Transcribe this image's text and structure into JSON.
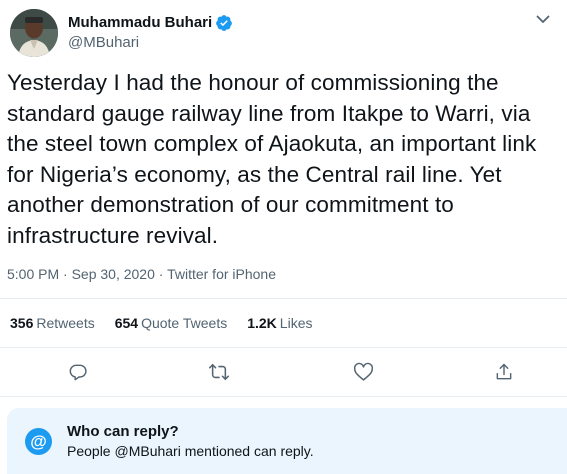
{
  "author": {
    "name": "Muhammadu Buhari",
    "handle": "@MBuhari",
    "verified": true
  },
  "tweet": {
    "text": "Yesterday I had the honour of commissioning the standard gauge railway line from Itakpe to Warri, via the steel town complex of Ajaokuta, an important link for Nigeria’s economy, as the Central rail line. Yet another demonstration of our commitment to infrastructure revival.",
    "meta": "5:00 PM · Sep 30, 2020 · Twitter for iPhone"
  },
  "stats": {
    "retweets_count": "356",
    "retweets_label": "Retweets",
    "quotes_count": "654",
    "quotes_label": "Quote Tweets",
    "likes_count": "1.2K",
    "likes_label": "Likes"
  },
  "reply_restriction": {
    "icon": "@",
    "title": "Who can reply?",
    "subtitle": "People @MBuhari mentioned can reply."
  },
  "icons": {
    "verified": "verified-badge-icon",
    "more": "chevron-down-icon",
    "reply": "reply-icon",
    "retweet": "retweet-icon",
    "like": "heart-icon",
    "share": "share-icon"
  },
  "colors": {
    "accent": "#1d9bf0",
    "secondary_text": "#536471",
    "reply_box_bg": "#eaf5fd"
  }
}
